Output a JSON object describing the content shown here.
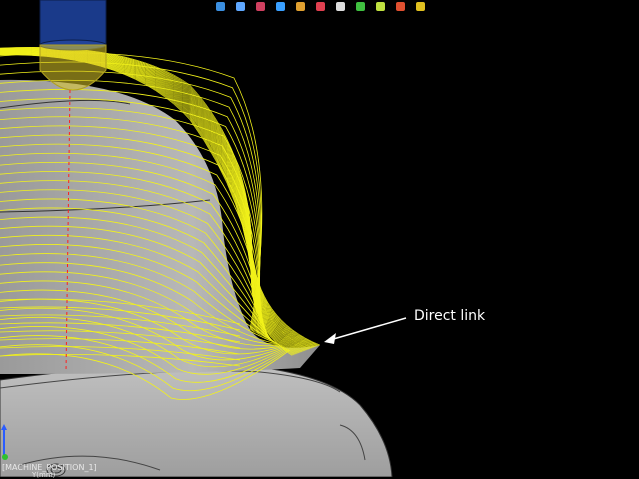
{
  "toolbar": {
    "icons": [
      "cylinder-icon",
      "wire-box-icon",
      "box-icon",
      "shaded-box-icon",
      "color-box-icon",
      "red-box-icon",
      "eraser-icon",
      "rotate-icon",
      "link-icon",
      "link-red-icon",
      "arrow-icon"
    ]
  },
  "annotation": {
    "label": "Direct link"
  },
  "status": {
    "position_name": "[MACHINE_POSITION_1]",
    "units": "Y(mm)"
  },
  "colors": {
    "background": "#000000",
    "toolpath": "#f2f21a",
    "part": "#b4b4b4",
    "tool": "#1a3a8a",
    "centerline": "#ff2020"
  }
}
